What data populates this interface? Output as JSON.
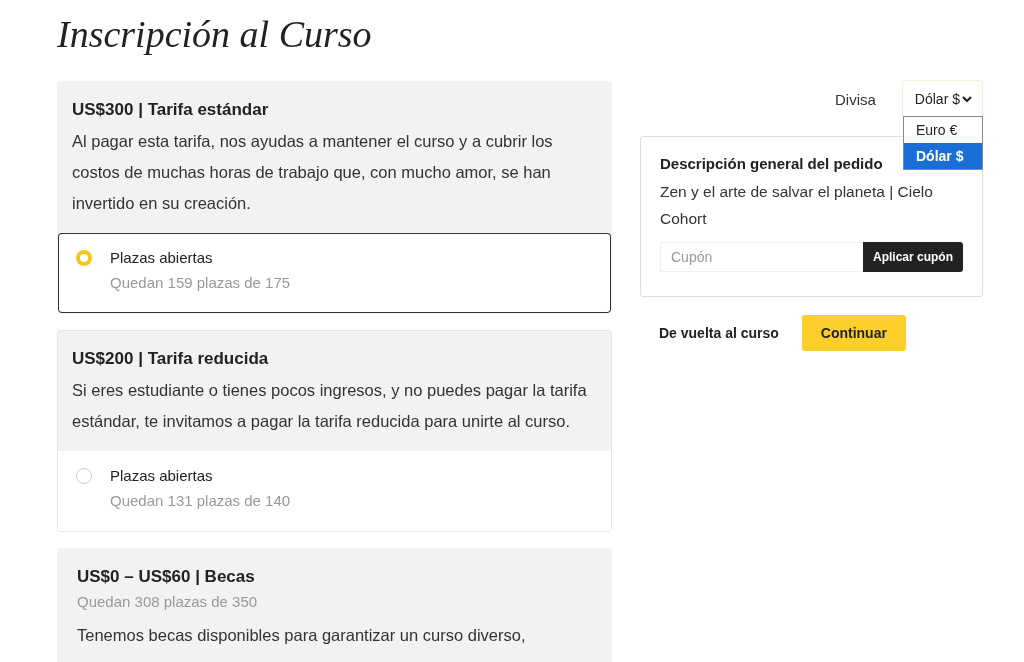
{
  "page_title": "Inscripción al Curso",
  "tiers": [
    {
      "kind": "option",
      "title": "US$300 | Tarifa estándar",
      "description": "Al pagar esta tarifa, nos ayudas a mantener el curso y a cubrir los costos de muchas horas de trabajo que, con mucho amor, se han invertido en su creación.",
      "option_label": "Plazas abiertas",
      "remaining": "Quedan 159 plazas de 175",
      "selected": true
    },
    {
      "kind": "option",
      "title": "US$200 | Tarifa reducida",
      "description": "Si eres estudiante o tienes pocos ingresos, y no puedes pagar la tarifa estándar, te invitamos a pagar la tarifa reducida para unirte al curso.",
      "option_label": "Plazas abiertas",
      "remaining": "Quedan 131 plazas de 140",
      "selected": false
    },
    {
      "kind": "scholarship",
      "title": "US$0 – US$60 | Becas",
      "remaining": "Quedan 308 plazas de 350",
      "description": "Tenemos becas disponibles para garantizar un curso diverso,"
    }
  ],
  "currency": {
    "label": "Divisa",
    "value": "Dólar $",
    "expanded": true,
    "options": [
      {
        "label": "Euro €",
        "selected": false
      },
      {
        "label": "Dólar $",
        "selected": true
      }
    ]
  },
  "order": {
    "title": "Descripción general del pedido",
    "description": "Zen y el arte de salvar el planeta | Cielo Cohort",
    "coupon_placeholder": "Cupón",
    "apply_button": "Aplicar cupón"
  },
  "back_link": "De vuelta al curso",
  "continue_button": "Continuar"
}
